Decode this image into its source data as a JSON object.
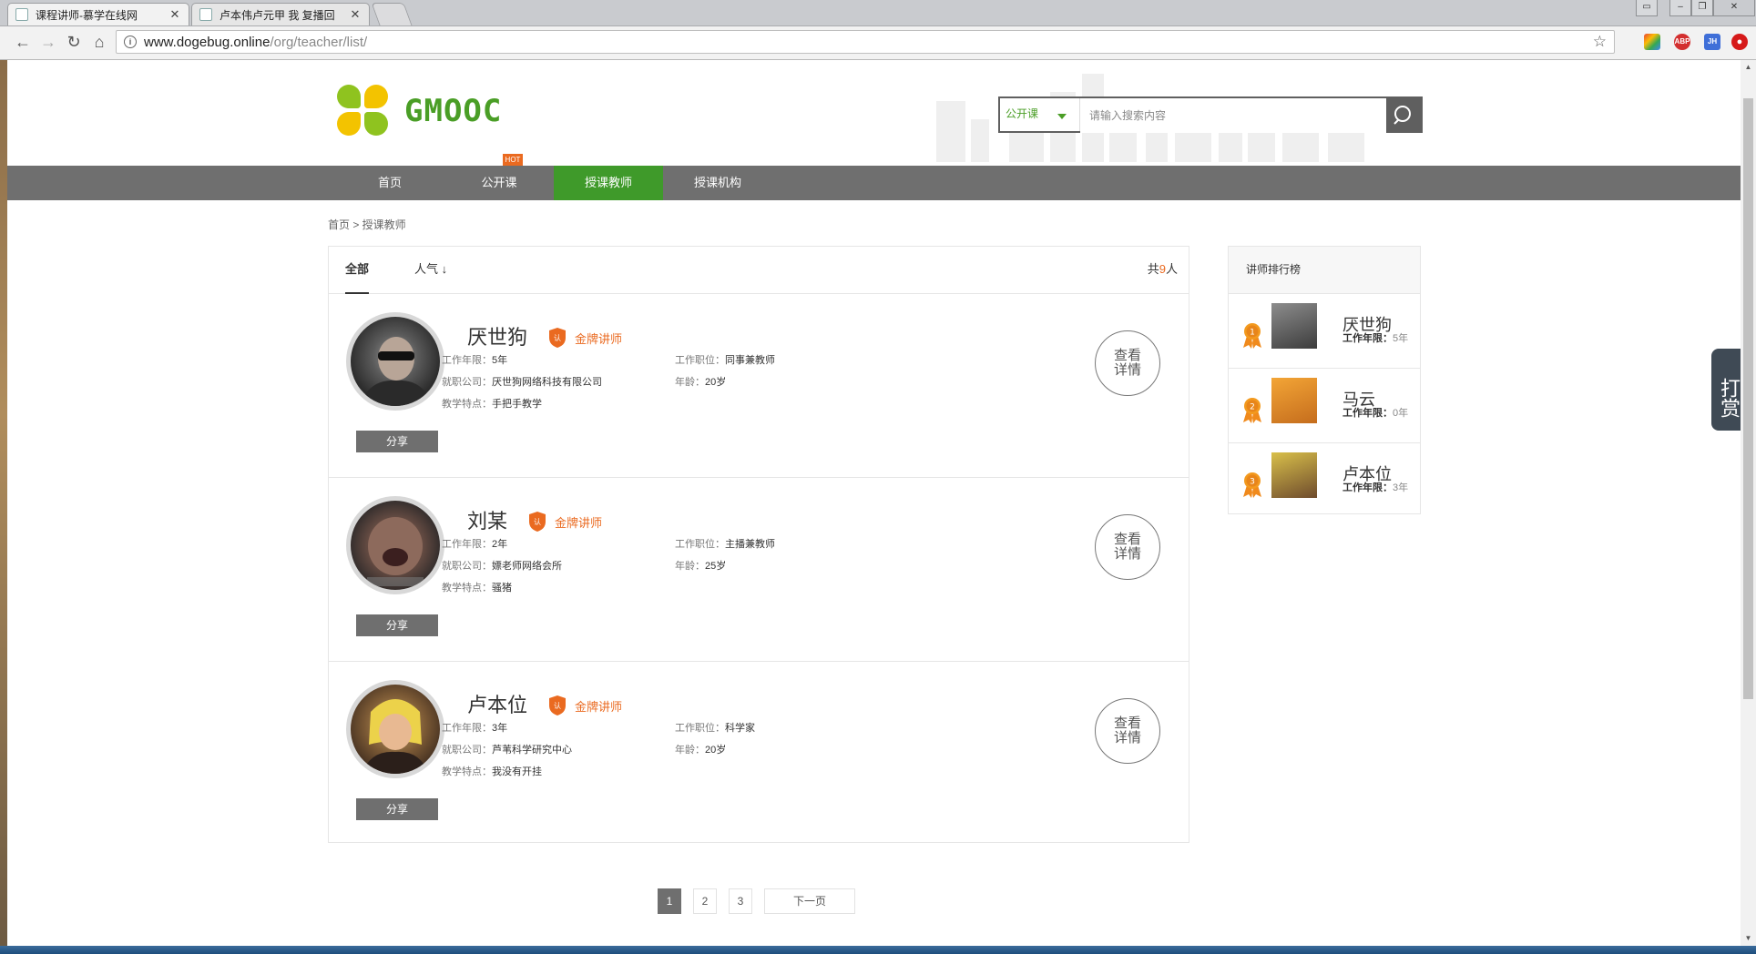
{
  "browser": {
    "tabs": [
      {
        "title": "课程讲师-慕学在线网",
        "active": true
      },
      {
        "title": "卢本伟卢元甲 我 复播回",
        "active": false
      }
    ],
    "url_host": "www.dogebug.online",
    "url_path": "/org/teacher/list/",
    "extensions": [
      "Chrome-store",
      "ABP",
      "JH",
      "red-ext"
    ]
  },
  "site": {
    "logo_text": "GMOOC",
    "search": {
      "type": "公开课",
      "placeholder": "请输入搜索内容"
    },
    "nav": [
      {
        "label": "首页",
        "active": false
      },
      {
        "label": "公开课",
        "active": false,
        "badge": "HOT"
      },
      {
        "label": "授课教师",
        "active": true
      },
      {
        "label": "授课机构",
        "active": false
      }
    ],
    "breadcrumb": "首页 > 授课教师"
  },
  "list": {
    "tabs": [
      "全部",
      "人气 ↓"
    ],
    "total_prefix": "共",
    "total_count": "9",
    "total_suffix": "人",
    "labels": {
      "work_years": "工作年限：",
      "position": "工作职位：",
      "company": "就职公司：",
      "age": "年龄：",
      "feature": "教学特点：",
      "share": "分享",
      "detail": "查看详情",
      "badge": "金牌讲师"
    },
    "teachers": [
      {
        "name": "厌世狗",
        "work_years": "5年",
        "position": "同事兼教师",
        "company": "厌世狗网络科技有限公司",
        "age": "20岁",
        "feature": "手把手教学"
      },
      {
        "name": "刘某",
        "work_years": "2年",
        "position": "主播兼教师",
        "company": "嫖老师网络会所",
        "age": "25岁",
        "feature": "骚猪"
      },
      {
        "name": "卢本位",
        "work_years": "3年",
        "position": "科学家",
        "company": "芦苇科学研究中心",
        "age": "20岁",
        "feature": "我没有开挂"
      }
    ]
  },
  "ranking": {
    "title": "讲师排行榜",
    "label": "工作年限：",
    "items": [
      {
        "rank": "1",
        "name": "厌世狗",
        "years": "5年"
      },
      {
        "rank": "2",
        "name": "马云",
        "years": "0年"
      },
      {
        "rank": "3",
        "name": "卢本位",
        "years": "3年"
      }
    ]
  },
  "pagination": {
    "pages": [
      "1",
      "2",
      "3"
    ],
    "current": "1",
    "next": "下一页"
  },
  "reward": "打赏",
  "colors": {
    "brand_green": "#3f9a2a",
    "accent_orange": "#ea6a20",
    "nav_gray": "#6f6f6f"
  }
}
